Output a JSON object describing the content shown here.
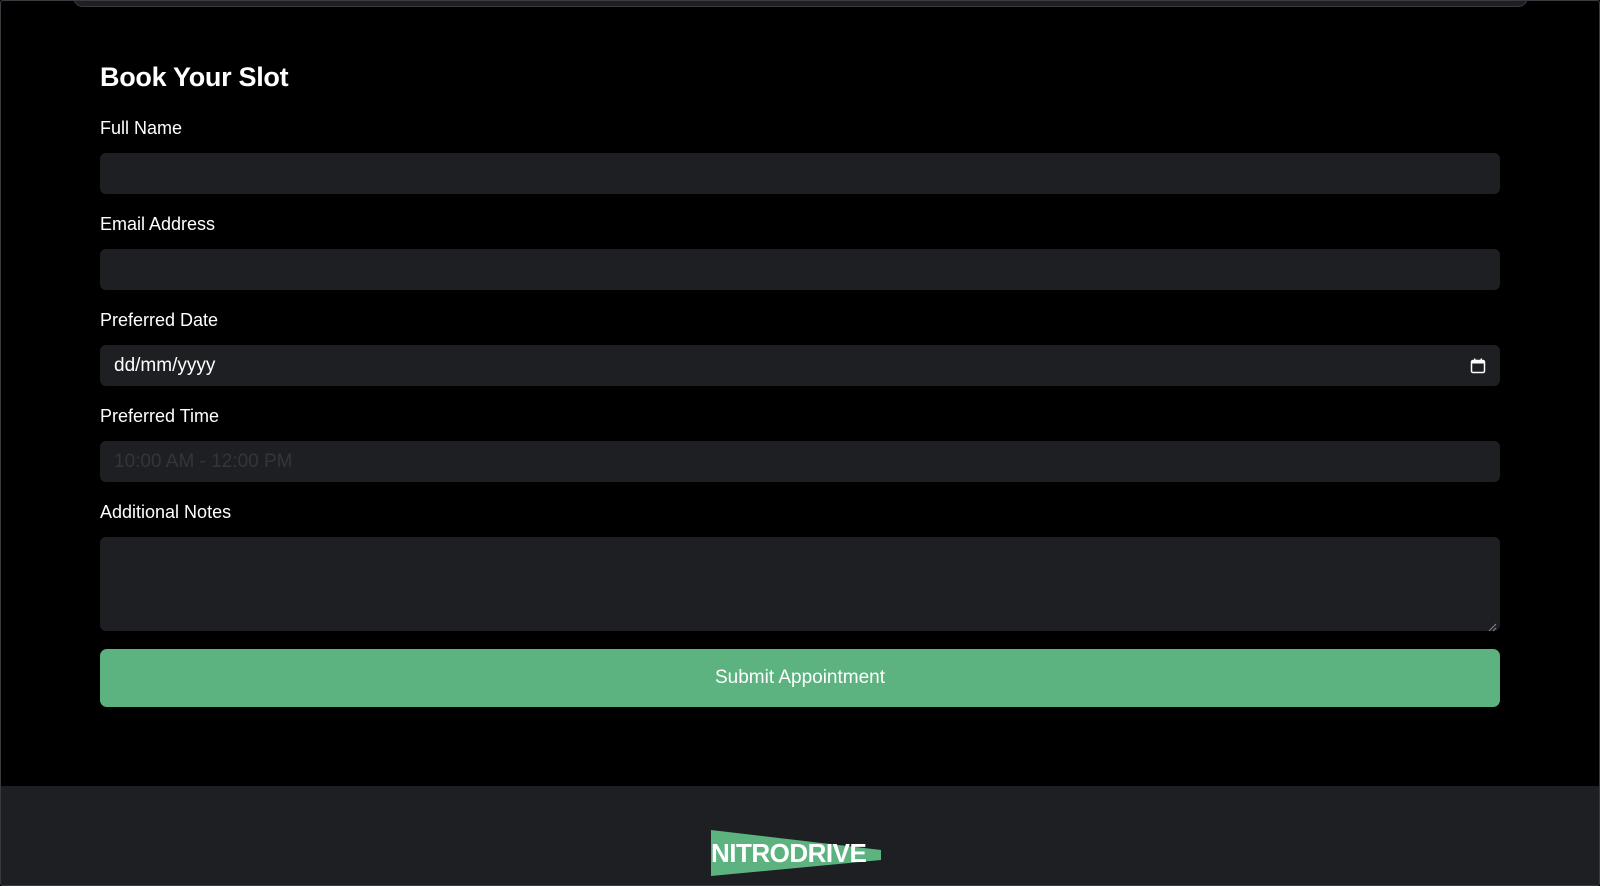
{
  "form": {
    "title": "Book Your Slot",
    "fields": {
      "full_name": {
        "label": "Full Name",
        "value": ""
      },
      "email": {
        "label": "Email Address",
        "value": ""
      },
      "date": {
        "label": "Preferred Date",
        "value": "dd/mm/yyyy",
        "icon": "calendar-icon"
      },
      "time": {
        "label": "Preferred Time",
        "placeholder": "10:00 AM - 12:00 PM"
      },
      "notes": {
        "label": "Additional Notes",
        "value": ""
      }
    },
    "submit_label": "Submit Appointment"
  },
  "footer": {
    "brand": "NITRODRIVE"
  },
  "colors": {
    "background": "#000000",
    "surface": "#1e1f23",
    "accent": "#5cb37f",
    "text": "#ffffff"
  }
}
